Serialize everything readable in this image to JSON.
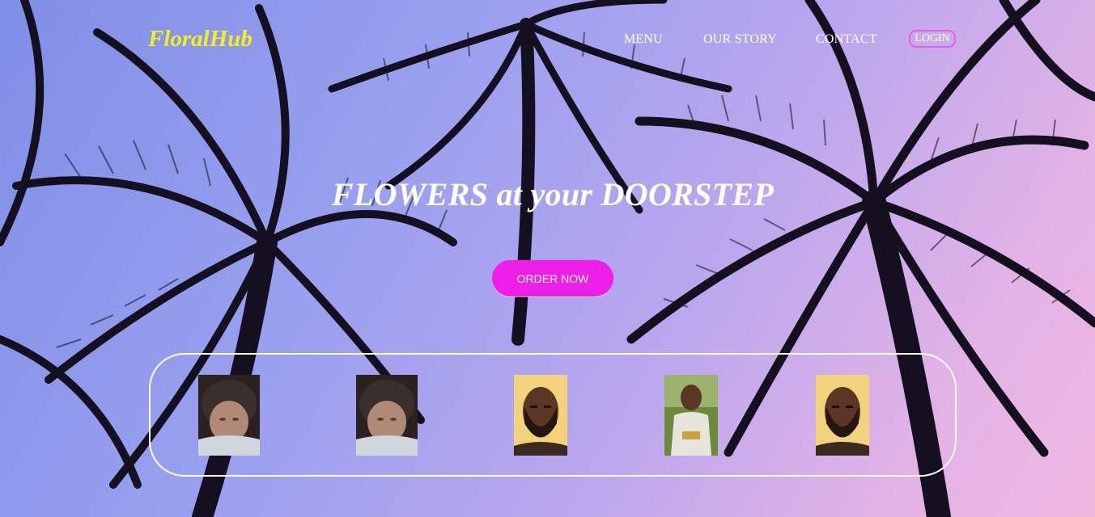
{
  "brand": {
    "logo": "FloralHub",
    "logo_color": "#f4f01e"
  },
  "nav": {
    "items": [
      {
        "label": "MENU"
      },
      {
        "label": "OUR STORY"
      },
      {
        "label": "CONTACT"
      }
    ],
    "login_label": "LOGIN"
  },
  "hero": {
    "title": "FLOWERS at your DOORSTEP",
    "cta_label": "ORDER NOW",
    "cta_color": "#ee1ee9"
  },
  "gallery": {
    "photos": [
      {
        "name": "baby-photo"
      },
      {
        "name": "baby-photo"
      },
      {
        "name": "man-portrait"
      },
      {
        "name": "man-outdoor-photo"
      },
      {
        "name": "man-portrait"
      }
    ]
  }
}
